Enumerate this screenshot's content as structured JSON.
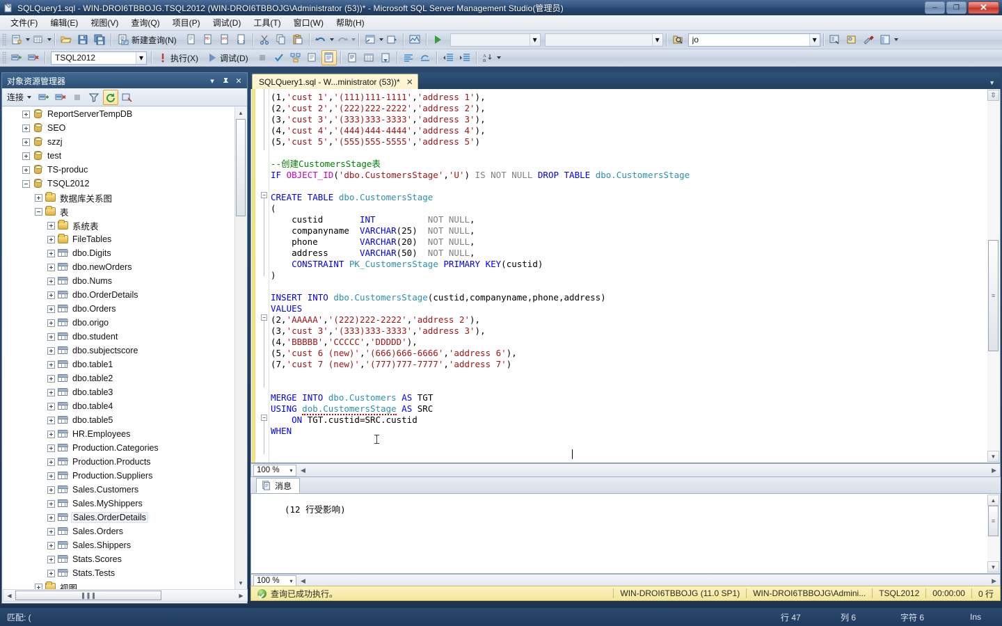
{
  "window": {
    "title": "SQLQuery1.sql - WIN-DROI6TBBOJG.TSQL2012 (WIN-DROI6TBBOJG\\Administrator (53))* - Microsoft SQL Server Management Studio(管理员)",
    "minimize_label": "─",
    "maximize_label": "❐",
    "close_label": "✕"
  },
  "menu": {
    "items": [
      {
        "label": "文件(F)",
        "name": "menu-file"
      },
      {
        "label": "编辑(E)",
        "name": "menu-edit"
      },
      {
        "label": "视图(V)",
        "name": "menu-view"
      },
      {
        "label": "查询(Q)",
        "name": "menu-query"
      },
      {
        "label": "项目(P)",
        "name": "menu-project"
      },
      {
        "label": "调试(D)",
        "name": "menu-debug"
      },
      {
        "label": "工具(T)",
        "name": "menu-tools"
      },
      {
        "label": "窗口(W)",
        "name": "menu-window"
      },
      {
        "label": "帮助(H)",
        "name": "menu-help"
      }
    ]
  },
  "toolbar_standard": {
    "new_query_label": "新建查询(N)",
    "combo_placeholder": "",
    "search_value": "jo",
    "empty_combo_value": ""
  },
  "toolbar_editor": {
    "database_value": "TSQL2012",
    "execute_label": "执行(X)",
    "debug_label": "调试(D)"
  },
  "object_explorer": {
    "title": "对象资源管理器",
    "connect_label": "连接",
    "tree": [
      {
        "label": "ReportServerTempDB",
        "icon": "database-icon",
        "indent": 1,
        "state": "plus"
      },
      {
        "label": "SEO",
        "icon": "database-icon",
        "indent": 1,
        "state": "plus"
      },
      {
        "label": "szzj",
        "icon": "database-icon",
        "indent": 1,
        "state": "plus"
      },
      {
        "label": "test",
        "icon": "database-icon",
        "indent": 1,
        "state": "plus"
      },
      {
        "label": "TS-produc",
        "icon": "database-icon",
        "indent": 1,
        "state": "plus"
      },
      {
        "label": "TSQL2012",
        "icon": "database-icon",
        "indent": 1,
        "state": "minus"
      },
      {
        "label": "数据库关系图",
        "icon": "folder-icon",
        "indent": 2,
        "state": "plus"
      },
      {
        "label": "表",
        "icon": "folder-icon",
        "indent": 2,
        "state": "minus"
      },
      {
        "label": "系统表",
        "icon": "folder-icon",
        "indent": 3,
        "state": "plus"
      },
      {
        "label": "FileTables",
        "icon": "folder-icon",
        "indent": 3,
        "state": "plus"
      },
      {
        "label": "dbo.Digits",
        "icon": "table-icon",
        "indent": 3,
        "state": "plus"
      },
      {
        "label": "dbo.newOrders",
        "icon": "table-icon",
        "indent": 3,
        "state": "plus"
      },
      {
        "label": "dbo.Nums",
        "icon": "table-icon",
        "indent": 3,
        "state": "plus"
      },
      {
        "label": "dbo.OrderDetails",
        "icon": "table-icon",
        "indent": 3,
        "state": "plus"
      },
      {
        "label": "dbo.Orders",
        "icon": "table-icon",
        "indent": 3,
        "state": "plus"
      },
      {
        "label": "dbo.origo",
        "icon": "table-icon",
        "indent": 3,
        "state": "plus"
      },
      {
        "label": "dbo.student",
        "icon": "table-icon",
        "indent": 3,
        "state": "plus"
      },
      {
        "label": "dbo.subjectscore",
        "icon": "table-icon",
        "indent": 3,
        "state": "plus"
      },
      {
        "label": "dbo.table1",
        "icon": "table-icon",
        "indent": 3,
        "state": "plus"
      },
      {
        "label": "dbo.table2",
        "icon": "table-icon",
        "indent": 3,
        "state": "plus"
      },
      {
        "label": "dbo.table3",
        "icon": "table-icon",
        "indent": 3,
        "state": "plus"
      },
      {
        "label": "dbo.table4",
        "icon": "table-icon",
        "indent": 3,
        "state": "plus"
      },
      {
        "label": "dbo.table5",
        "icon": "table-icon",
        "indent": 3,
        "state": "plus"
      },
      {
        "label": "HR.Employees",
        "icon": "table-icon",
        "indent": 3,
        "state": "plus"
      },
      {
        "label": "Production.Categories",
        "icon": "table-icon",
        "indent": 3,
        "state": "plus"
      },
      {
        "label": "Production.Products",
        "icon": "table-icon",
        "indent": 3,
        "state": "plus"
      },
      {
        "label": "Production.Suppliers",
        "icon": "table-icon",
        "indent": 3,
        "state": "plus"
      },
      {
        "label": "Sales.Customers",
        "icon": "table-icon",
        "indent": 3,
        "state": "plus"
      },
      {
        "label": "Sales.MyShippers",
        "icon": "table-icon",
        "indent": 3,
        "state": "plus"
      },
      {
        "label": "Sales.OrderDetails",
        "icon": "table-icon",
        "indent": 3,
        "state": "plus",
        "highlight": true
      },
      {
        "label": "Sales.Orders",
        "icon": "table-icon",
        "indent": 3,
        "state": "plus"
      },
      {
        "label": "Sales.Shippers",
        "icon": "table-icon",
        "indent": 3,
        "state": "plus"
      },
      {
        "label": "Stats.Scores",
        "icon": "table-icon",
        "indent": 3,
        "state": "plus"
      },
      {
        "label": "Stats.Tests",
        "icon": "table-icon",
        "indent": 3,
        "state": "plus"
      },
      {
        "label": "视图",
        "icon": "folder-icon",
        "indent": 2,
        "state": "plus"
      }
    ]
  },
  "editor": {
    "tab_label": "SQLQuery1.sql - W...ministrator (53))*",
    "tab_close": "✕",
    "zoom_top": "100 %",
    "zoom_bottom": "100 %",
    "lines": [
      "(1,'cust 1','(111)111-1111','address 1'),",
      "(2,'cust 2','(222)222-2222','address 2'),",
      "(3,'cust 3','(333)333-3333','address 3'),",
      "(4,'cust 4','(444)444-4444','address 4'),",
      "(5,'cust 5','(555)555-5555','address 5')",
      "",
      "--创建CustomersStage表",
      "IF OBJECT_ID('dbo.CustomersStage','U') IS NOT NULL DROP TABLE dbo.CustomersStage",
      "",
      "CREATE TABLE dbo.CustomersStage",
      "(",
      "    custid       INT          NOT NULL,",
      "    companyname  VARCHAR(25)  NOT NULL,",
      "    phone        VARCHAR(20)  NOT NULL,",
      "    address      VARCHAR(50)  NOT NULL,",
      "    CONSTRAINT PK_CustomersStage PRIMARY KEY(custid)",
      ")",
      "",
      "INSERT INTO dbo.CustomersStage(custid,companyname,phone,address)",
      "VALUES",
      "(2,'AAAAA','(222)222-2222','address 2'),",
      "(3,'cust 3','(333)333-3333','address 3'),",
      "(4,'BBBBB','CCCCC','DDDDD'),",
      "(5,'cust 6 (new)','(666)666-6666','address 6'),",
      "(7,'cust 7 (new)','(777)777-7777','address 7')",
      "",
      "",
      "MERGE INTO dbo.Customers AS TGT",
      "USING dob.CustomersStage AS SRC",
      "    ON TGT.custid=SRC.custid",
      "WHEN "
    ]
  },
  "results": {
    "tab_label": "消息",
    "message": "(12 行受影响)"
  },
  "status_bar": {
    "execution_text": "查询已成功执行。",
    "server": "WIN-DROI6TBBOJG (11.0 SP1)",
    "user": "WIN-DROI6TBBOJG\\Admini...",
    "database": "TSQL2012",
    "duration": "00:00:00",
    "rows": "0 行"
  },
  "bottom_bar": {
    "match_text": "匹配: (",
    "line": "行 47",
    "column": "列 6",
    "character": "字符 6",
    "insert_mode": "Ins"
  }
}
